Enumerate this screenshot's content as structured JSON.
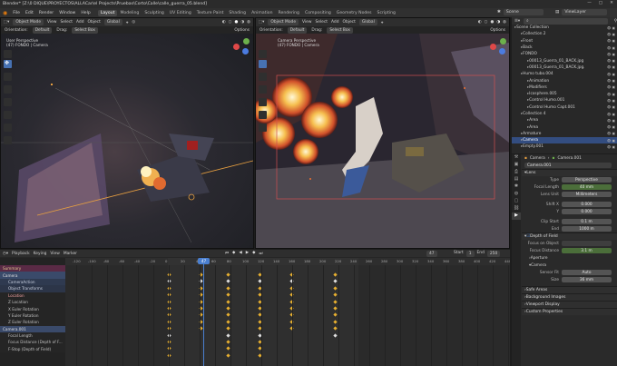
{
  "titlebar": {
    "title": "Blender* [Z:\\0 DIQUE\\PROYECTOS\\ALLACar\\el Projects\\Pruebas\\Corto\\Calle\\calle_guerra_05.blend]"
  },
  "menu": [
    "File",
    "Edit",
    "Render",
    "Window",
    "Help"
  ],
  "workspaces": [
    "Layout",
    "Modeling",
    "Sculpting",
    "UV Editing",
    "Texture Paint",
    "Shading",
    "Animation",
    "Rendering",
    "Compositing",
    "Geometry Nodes",
    "Scripting"
  ],
  "active_workspace": "Layout",
  "scene": {
    "name": "Scene",
    "view_layer": "ViewLayer"
  },
  "vp_left": {
    "mode": "Object Mode",
    "menus": [
      "View",
      "Select",
      "Add",
      "Object"
    ],
    "orient_menu": "Global",
    "orientation": "Orientation:",
    "orientation_val": "Default",
    "drag": "Drag:",
    "drag_val": "Select Box",
    "options": "Options",
    "overlay1": "User Perspective",
    "overlay2": "(47) FONDO | Camera"
  },
  "vp_right": {
    "mode": "Object Mode",
    "menus": [
      "View",
      "Select",
      "Add",
      "Object"
    ],
    "orient_menu": "Global",
    "orientation": "Orientation:",
    "orientation_val": "Default",
    "drag": "Drag:",
    "drag_val": "Select Box",
    "options": "Options",
    "overlay1": "Camera Perspective",
    "overlay2": "(47) FONDO | Camera"
  },
  "outliner": {
    "title": "Scene Collection",
    "rows": [
      {
        "indent": 0,
        "label": "Scene Collection",
        "color": "#d0d0d0"
      },
      {
        "indent": 1,
        "label": "Collection 2",
        "color": "#d0d0d0"
      },
      {
        "indent": 1,
        "label": "Front",
        "color": "#d0d0d0"
      },
      {
        "indent": 1,
        "label": "Back",
        "color": "#d0d0d0"
      },
      {
        "indent": 1,
        "label": "FONDO",
        "color": "#d0d0d0"
      },
      {
        "indent": 2,
        "label": "00013_Guerra_01_BACK.jpg",
        "color": "#d0d0d0"
      },
      {
        "indent": 2,
        "label": "00013_Guerra_01_BACK.jpg.",
        "color": "#d0d0d0"
      },
      {
        "indent": 1,
        "label": "Humo tubo.004",
        "color": "#d0d0d0"
      },
      {
        "indent": 2,
        "label": "Animation",
        "color": "#d0d0d0"
      },
      {
        "indent": 2,
        "label": "Modifiers",
        "color": "#d0d0d0"
      },
      {
        "indent": 2,
        "label": "Icosphere.005",
        "color": "#d0d0d0"
      },
      {
        "indent": 2,
        "label": "Control Humo.001",
        "color": "#d0d0d0"
      },
      {
        "indent": 2,
        "label": "Control Humo Capt.001",
        "color": "#d0d0d0"
      },
      {
        "indent": 1,
        "label": "Collection 4",
        "color": "#d0d0d0"
      },
      {
        "indent": 2,
        "label": "Area",
        "color": "#d0d0d0"
      },
      {
        "indent": 2,
        "label": "Area",
        "color": "#d0d0d0"
      },
      {
        "indent": 1,
        "label": "Armature",
        "color": "#d0d0d0"
      },
      {
        "indent": 1,
        "label": "Camera",
        "color": "#ffffff",
        "selected": true
      },
      {
        "indent": 1,
        "label": "Empty.001",
        "color": "#d0d0d0"
      }
    ]
  },
  "properties": {
    "breadcrumb_obj": "Camera",
    "breadcrumb_data": "Camera.001",
    "datablock": "Camera.001",
    "lens_header": "Lens",
    "type_label": "Type",
    "type_val": "Perspective",
    "focal_label": "Focal Length",
    "focal_val": "40 mm",
    "units_label": "Lens Unit",
    "units_val": "Millimeters",
    "shiftx_label": "Shift X",
    "shiftx_val": "0.000",
    "shifty_label": "Y",
    "shifty_val": "0.000",
    "clipstart_label": "Clip Start",
    "clipstart_val": "0.1 m",
    "clipend_label": "End",
    "clipend_val": "1000 m",
    "dof_header": "Depth of Field",
    "focus_obj_label": "Focus on Object",
    "focus_dist_label": "Focus Distance",
    "focus_dist_val": "3.1 m",
    "aperture": "Aperture",
    "camera_header": "Camera",
    "sensor_fit_label": "Sensor Fit",
    "sensor_fit_val": "Auto",
    "size_label": "Size",
    "size_val": "36 mm",
    "safe_areas": "Safe Areas",
    "background_images": "Background Images",
    "viewport_display": "Viewport Display",
    "custom_properties": "Custom Properties"
  },
  "timeline": {
    "menus": [
      "Playback",
      "Keying",
      "View",
      "Marker"
    ],
    "current_frame": "47",
    "start_label": "Start",
    "start": "1",
    "end_label": "End",
    "end": "250",
    "ruler": [
      "-120",
      "-100",
      "-80",
      "-60",
      "-40",
      "-20",
      "0",
      "20",
      "40",
      "60",
      "80",
      "100",
      "120",
      "140",
      "160",
      "180",
      "200",
      "220",
      "240",
      "260",
      "280",
      "300",
      "320",
      "340",
      "360",
      "380",
      "400",
      "420",
      "440"
    ],
    "channels": [
      {
        "label": "Summary",
        "color": "#e0c890",
        "bg": "#5a2a45"
      },
      {
        "label": "Camera",
        "color": "#e0e0e0",
        "bg": "#3a4a6a"
      },
      {
        "label": "CameraAction",
        "color": "#c8d0e0",
        "bg": "#2f3a50"
      },
      {
        "label": "Object Transforms",
        "color": "#c8d0e0",
        "bg": "#2c3548"
      },
      {
        "label": "Location",
        "color": "#f0a0a0",
        "bg": "#252525"
      },
      {
        "label": "Z Location",
        "color": "#c0c0c0",
        "bg": "#252525"
      },
      {
        "label": "X Euler Rotation",
        "color": "#c0c0c0",
        "bg": "#252525"
      },
      {
        "label": "Y Euler Rotation",
        "color": "#c0c0c0",
        "bg": "#252525"
      },
      {
        "label": "Z Euler Rotation",
        "color": "#c0c0c0",
        "bg": "#252525"
      },
      {
        "label": "Camera.001",
        "color": "#e0e0e0",
        "bg": "#3a4a6a"
      },
      {
        "label": "Focal Length",
        "color": "#c0c0c0",
        "bg": "#252525"
      },
      {
        "label": "Focus Distance (Depth of F...",
        "color": "#c0c0c0",
        "bg": "#252525"
      },
      {
        "label": "F-Stop (Depth of Field)",
        "color": "#c0c0c0",
        "bg": "#252525"
      }
    ]
  },
  "colors": {
    "accent": "#4772b3",
    "keyframe": "#e8b030",
    "playhead": "#4a7fd0",
    "active_ws": "#474747"
  }
}
